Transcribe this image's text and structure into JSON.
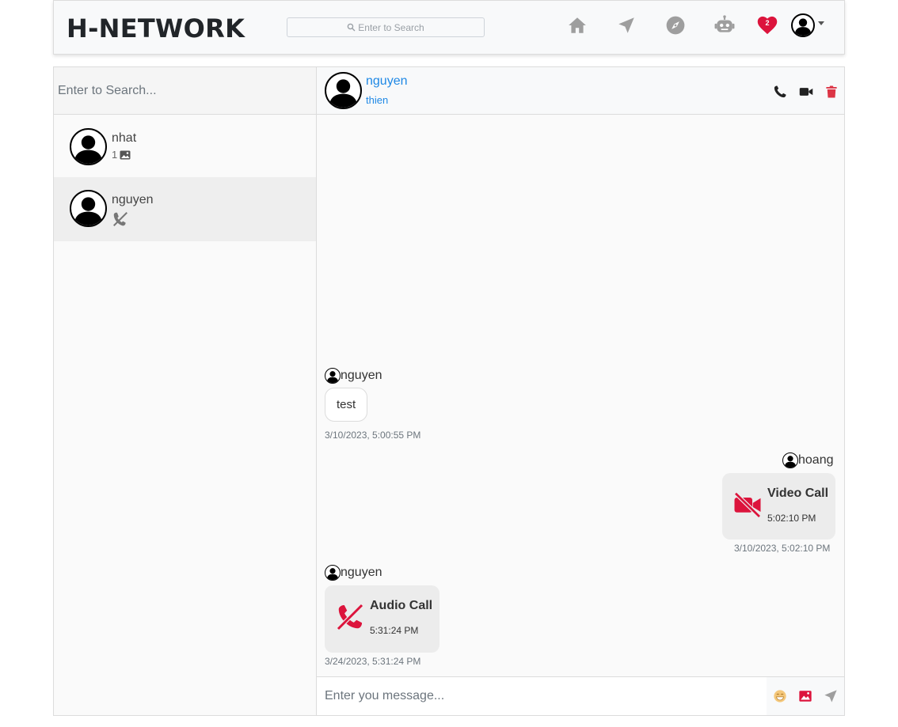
{
  "app": {
    "brand": "H-NETWORK",
    "search_placeholder": "Enter to Search",
    "nav_icons": [
      "home-icon",
      "send-icon",
      "compass-icon",
      "robot-icon",
      "heart-icon",
      "user-avatar"
    ],
    "notification_count": "2",
    "colors": {
      "accent_blue": "#1e88e5",
      "danger_red": "#dc143c",
      "icon_grey": "#9e9e9e"
    }
  },
  "sidebar": {
    "search_placeholder": "Enter to Search...",
    "conversations": [
      {
        "name": "nhat",
        "preview_count": "1",
        "preview_icon": "image-icon",
        "active": false
      },
      {
        "name": "nguyen",
        "preview_icon": "missed-call-icon",
        "active": true
      }
    ]
  },
  "chat": {
    "name": "nguyen",
    "subtitle": "thien",
    "actions": [
      "phone-icon",
      "video-icon",
      "trash-icon"
    ],
    "messages": [
      {
        "sender": "nguyen",
        "type": "text",
        "text": "test",
        "timestamp": "3/10/2023, 5:00:55 PM",
        "side": "left"
      },
      {
        "sender": "hoang",
        "type": "video_call",
        "title": "Video Call",
        "time": "5:02:10 PM",
        "timestamp": "3/10/2023, 5:02:10 PM",
        "side": "right"
      },
      {
        "sender": "nguyen",
        "type": "audio_call",
        "title": "Audio Call",
        "time": "5:31:24 PM",
        "timestamp": "3/24/2023, 5:31:24 PM",
        "side": "left"
      }
    ],
    "composer_placeholder": "Enter you message...",
    "composer_icons": [
      "emoji-icon",
      "image-upload-icon",
      "send-icon"
    ]
  }
}
